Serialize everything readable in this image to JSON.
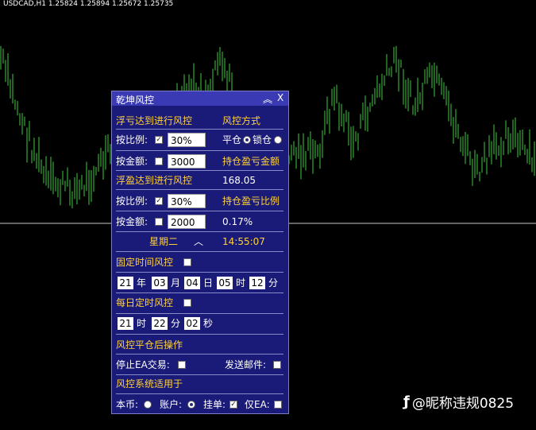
{
  "chart": {
    "symbol_info": "USDCAD,H1  1.25824 1.25894 1.25672 1.25735",
    "candle_color": "#3ec93e",
    "line_color": "#c8c8c8"
  },
  "watermark": {
    "logo": "ƒ",
    "text": "@昵称违规0825"
  },
  "panel": {
    "title": "乾坤风控",
    "collapse_glyph": "︽",
    "close_label": "X",
    "float_loss_label": "浮亏达到进行风控",
    "mode_label": "风控方式",
    "ratio_label_1": "按比例:",
    "ratio_checked_1": "✓",
    "ratio_value_1": "30%",
    "close_opt_label": "平仓",
    "lock_opt_label": "锁仓",
    "amount_label_1": "按金额:",
    "amount_value_1": "3000",
    "hold_pl_amount_label": "持仓盈亏金额",
    "float_profit_label": "浮盈达到进行风控",
    "hold_pl_amount_value": "168.05",
    "ratio_label_2": "按比例:",
    "ratio_checked_2": "✓",
    "ratio_value_2": "30%",
    "hold_pl_ratio_label": "持仓盈亏比例",
    "amount_label_2": "按金额:",
    "amount_value_2": "2000",
    "hold_pl_ratio_value": "0.17%",
    "weekday": "星期二",
    "up_glyph": "︿",
    "clock": "14:55:07",
    "fixed_time_label": "固定时间风控",
    "fixed": {
      "year": "21",
      "year_unit": "年",
      "month": "03",
      "month_unit": "月",
      "day": "04",
      "day_unit": "日",
      "hour": "05",
      "hour_unit": "时",
      "minute": "12",
      "minute_unit": "分"
    },
    "daily_time_label": "每日定时风控",
    "daily": {
      "hour": "21",
      "hour_unit": "时",
      "minute": "22",
      "minute_unit": "分",
      "second": "02",
      "second_unit": "秒"
    },
    "after_close_label": "风控平仓后操作",
    "stop_ea_label": "停止EA交易:",
    "send_mail_label": "发送邮件:",
    "apply_label": "风控系统适用于",
    "symbol_opt_label": "本币:",
    "account_opt_label": "账户:",
    "pending_label": "挂单:",
    "pending_checked": "✓",
    "only_ea_label": "仅EA:"
  }
}
